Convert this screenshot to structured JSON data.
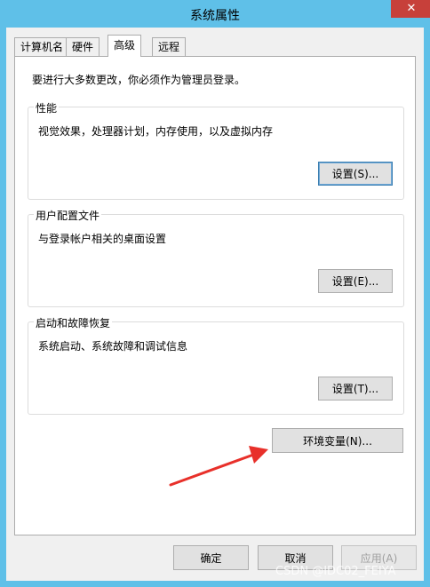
{
  "window": {
    "title": "系统属性",
    "close_glyph": "✕"
  },
  "tabs": [
    {
      "label": "计算机名"
    },
    {
      "label": "硬件"
    },
    {
      "label": "高级",
      "active": true
    },
    {
      "label": "远程"
    }
  ],
  "panel": {
    "intro": "要进行大多数更改，你必须作为管理员登录。",
    "performance": {
      "legend": "性能",
      "desc": "视觉效果，处理器计划，内存使用，以及虚拟内存",
      "button": "设置(S)..."
    },
    "user_profiles": {
      "legend": "用户配置文件",
      "desc": "与登录帐户相关的桌面设置",
      "button": "设置(E)..."
    },
    "startup_recovery": {
      "legend": "启动和故障恢复",
      "desc": "系统启动、系统故障和调试信息",
      "button": "设置(T)..."
    },
    "env_button": "环境变量(N)..."
  },
  "footer": {
    "ok": "确定",
    "cancel": "取消",
    "apply": "应用(A)"
  },
  "watermark": "CSDN @IDC02_FEIYA",
  "colors": {
    "arrow": "#e8302a",
    "frame": "#5fc0e8",
    "close": "#c7403a"
  }
}
